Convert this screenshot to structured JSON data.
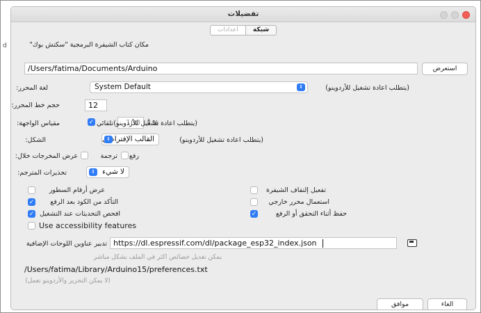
{
  "window": {
    "title": "تفضيلات"
  },
  "tabs": [
    {
      "label": "شبكة",
      "active": true
    },
    {
      "label": "اعدادات",
      "active": false
    }
  ],
  "sketchbook": {
    "label": "مكان كتاب الشيفرة البرمجية \"سكتش بوك\"",
    "path": "/Users/fatima/Documents/Arduino",
    "browse_label": "استعرض"
  },
  "editor_language": {
    "label": "لغة المحرر:",
    "value": "System Default",
    "note": "(يتطلب اعادة تشغيل للأردوينو)"
  },
  "font_size": {
    "label": "حجم خط المحرر:",
    "value": "12"
  },
  "scale": {
    "label": "مقياس الواجهة:",
    "auto_label": "تلقائي",
    "auto_checked": true,
    "value": "100",
    "unit": "%",
    "note": "(يتطلب اعادة تشغيل للأردوينو)"
  },
  "theme": {
    "label": "الشكل:",
    "value": "القالب الإفتراضي",
    "note": "(يتطلب اعادة تشغيل للأردوينو)"
  },
  "verbose": {
    "label": "عرض المخرجات خلال:",
    "compile_label": "ترجمة",
    "upload_label": "رفع",
    "compile_checked": false,
    "upload_checked": false
  },
  "warnings": {
    "label": "تحذيرات المترجم:",
    "value": "لا شيء"
  },
  "options_left": [
    {
      "label": "عرض أرقام السطور",
      "checked": false
    },
    {
      "label": "التأكد من الكود بعد الرفع",
      "checked": true
    },
    {
      "label": "افحص التحديثات عند التشغيل",
      "checked": true
    }
  ],
  "options_right": [
    {
      "label": "تفعيل إلتفاف الشيفرة",
      "checked": false
    },
    {
      "label": "استعمال محرر خارجي",
      "checked": false
    },
    {
      "label": "حفظ أثناء التحقق أو الرفع",
      "checked": true
    }
  ],
  "accessibility": {
    "label": "Use accessibility features",
    "checked": false
  },
  "board_urls": {
    "label": "تدبير عناوين اللوحات الإضافية",
    "value": "https://dl.espressif.com/dl/package_esp32_index.json"
  },
  "more_prefs_note": "يمكن تعديل خصائص اكثر في الملف بشكل مباشر",
  "prefs_path": "/Users/fatima/Library/Arduino15/preferences.txt",
  "edit_note": "(لا يمكن التحرير والأردوينو تعمل)",
  "footer": {
    "ok_label": "موافق",
    "cancel_label": "الغاء"
  }
}
